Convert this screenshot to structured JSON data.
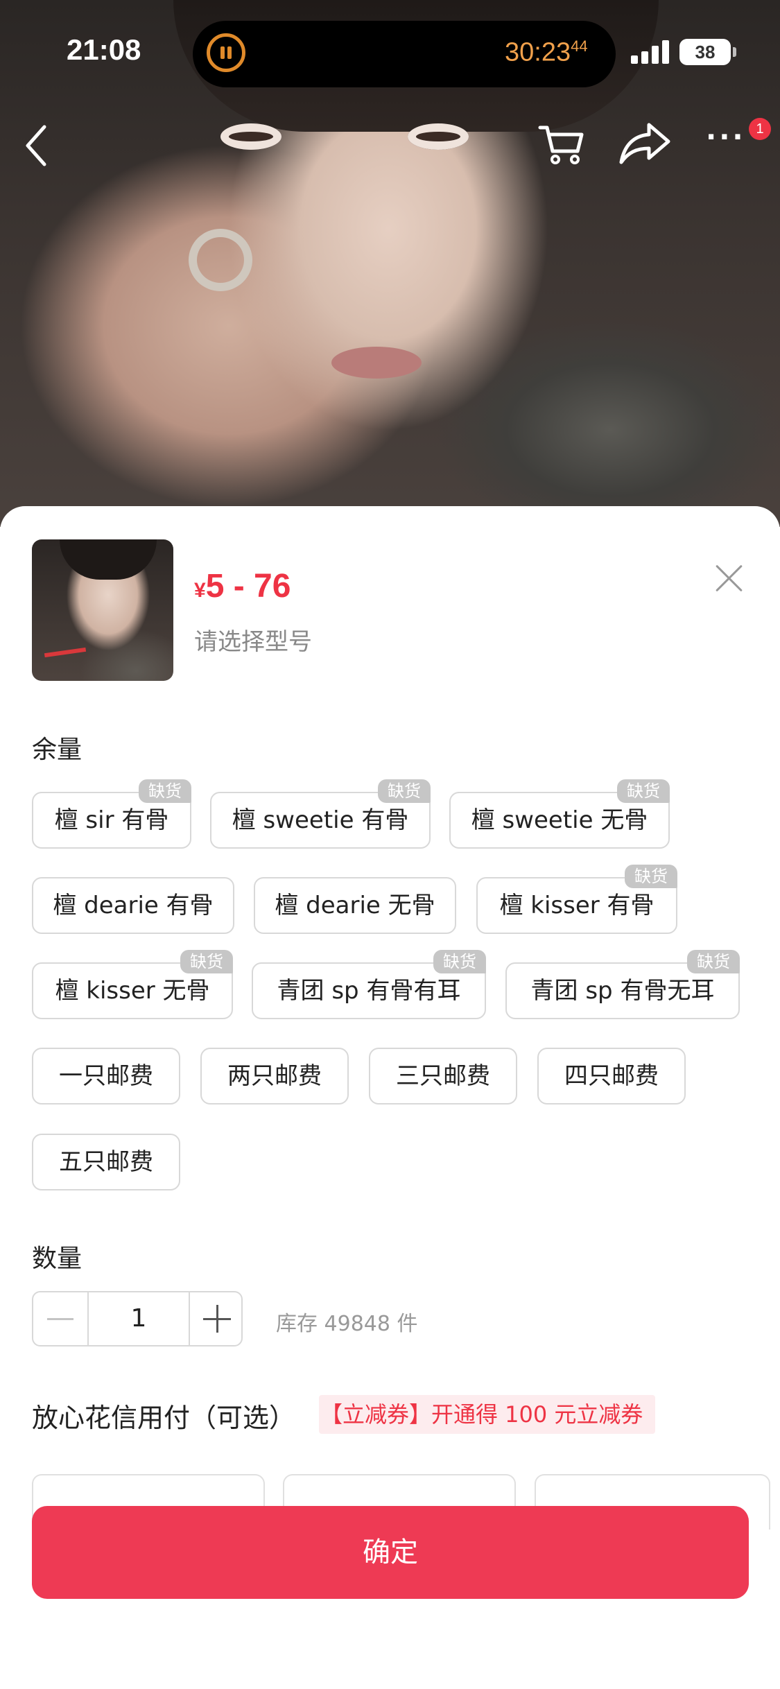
{
  "status_bar": {
    "time": "21:08",
    "timer": "30:23",
    "timer_fraction": "44",
    "battery": "38"
  },
  "nav": {
    "cart_badge": "1"
  },
  "product": {
    "currency": "¥",
    "price_range": "5 - 76",
    "select_hint": "请选择型号"
  },
  "options_section": {
    "label": "余量",
    "out_of_stock_tag": "缺货",
    "options": [
      {
        "label": "檀 sir 有骨",
        "out_of_stock": true
      },
      {
        "label": "檀 sweetie 有骨",
        "out_of_stock": true
      },
      {
        "label": "檀 sweetie 无骨",
        "out_of_stock": true
      },
      {
        "label": "檀 dearie 有骨",
        "out_of_stock": false
      },
      {
        "label": "檀 dearie 无骨",
        "out_of_stock": false
      },
      {
        "label": "檀 kisser 有骨",
        "out_of_stock": true
      },
      {
        "label": "檀 kisser 无骨",
        "out_of_stock": true
      },
      {
        "label": "青团 sp 有骨有耳",
        "out_of_stock": true
      },
      {
        "label": "青团 sp 有骨无耳",
        "out_of_stock": true
      },
      {
        "label": "一只邮费",
        "out_of_stock": false
      },
      {
        "label": "两只邮费",
        "out_of_stock": false
      },
      {
        "label": "三只邮费",
        "out_of_stock": false
      },
      {
        "label": "四只邮费",
        "out_of_stock": false
      },
      {
        "label": "五只邮费",
        "out_of_stock": false
      }
    ]
  },
  "quantity": {
    "label": "数量",
    "value": "1",
    "stock": "库存 49848 件"
  },
  "credit": {
    "title": "放心花信用付（可选）",
    "promo": "【立减券】开通得 100 元立减券"
  },
  "confirm_label": "确定",
  "colors": {
    "accent": "#ee3344",
    "confirm_bg": "#ee3a54",
    "tag_gray": "#c6c6c6",
    "timer_orange": "#f0a04b"
  }
}
